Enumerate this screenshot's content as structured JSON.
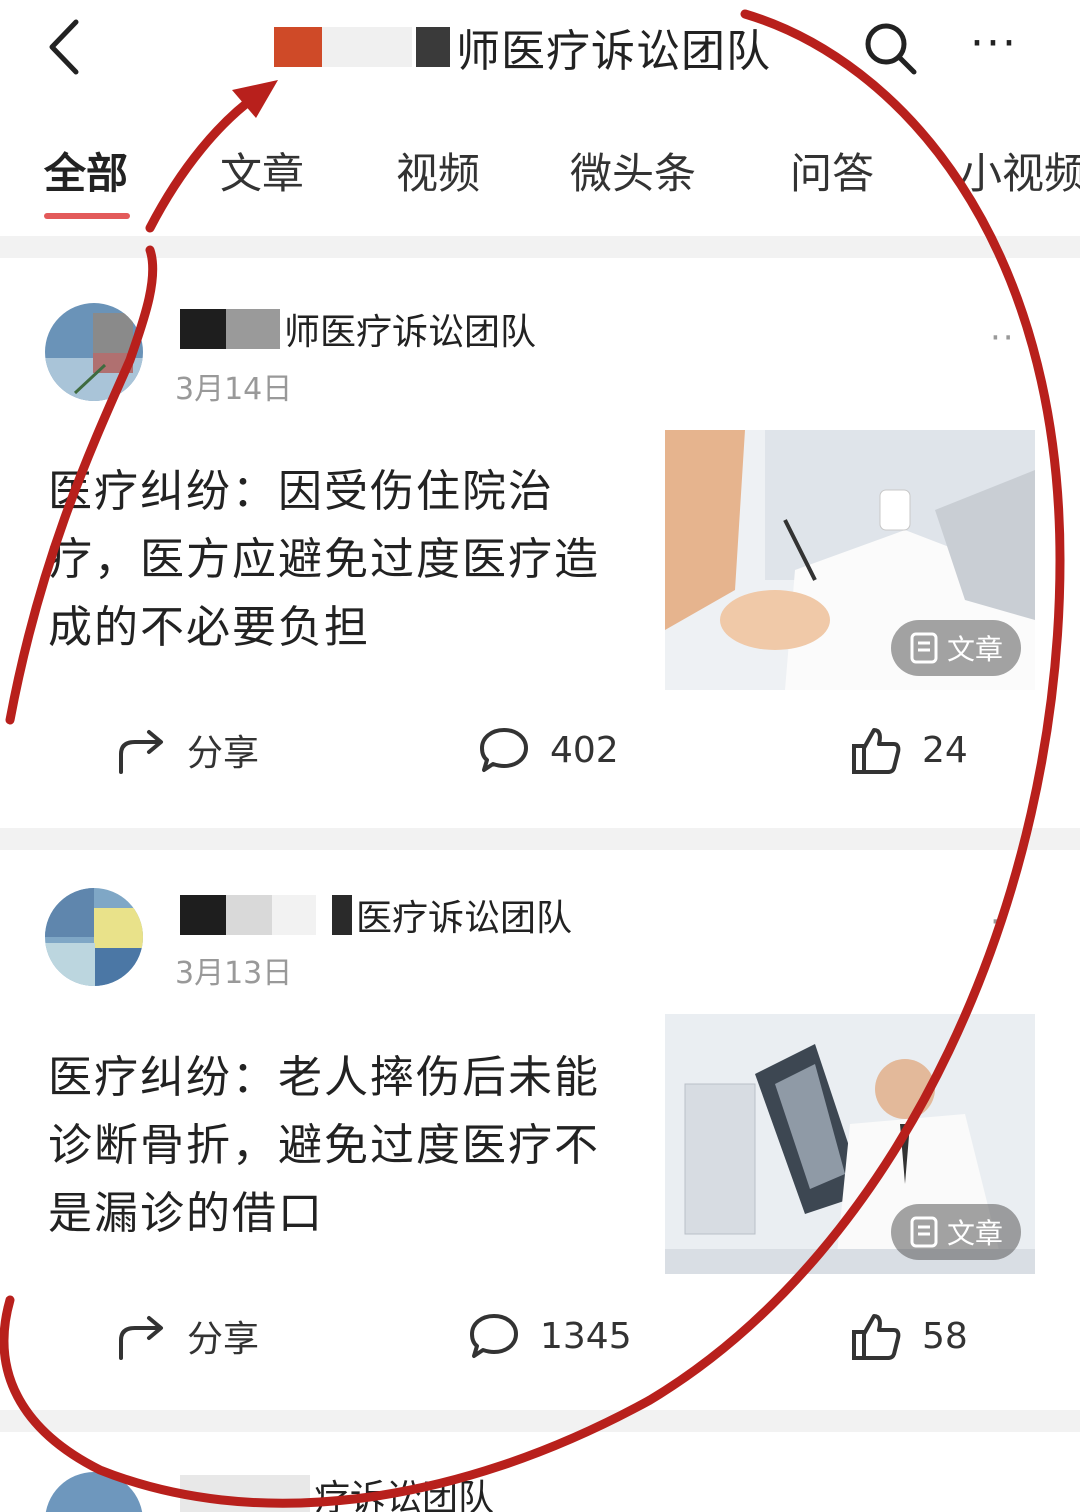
{
  "header": {
    "back_glyph": "<",
    "title": "师医疗诉讼团队",
    "more_glyph": "···"
  },
  "tabs": [
    "全部",
    "文章",
    "视频",
    "微头条",
    "问答",
    "小视频"
  ],
  "posts": [
    {
      "author": "师医疗诉讼团队",
      "date": "3月14日",
      "title": "医疗纠纷：因受伤住院治疗，医方应避免过度医疗造成的不必要负担",
      "badge": "文章",
      "share_label": "分享",
      "comments": "402",
      "likes": "24"
    },
    {
      "author": "医疗诉讼团队",
      "date": "3月13日",
      "title": "医疗纠纷：老人摔伤后未能诊断骨折，避免过度医疗不是漏诊的借口",
      "badge": "文章",
      "share_label": "分享",
      "comments": "1345",
      "likes": "58"
    }
  ],
  "partial_author": "疗诉讼团队",
  "colors": {
    "accent": "#e35a5a",
    "annotation": "#b8201c"
  }
}
